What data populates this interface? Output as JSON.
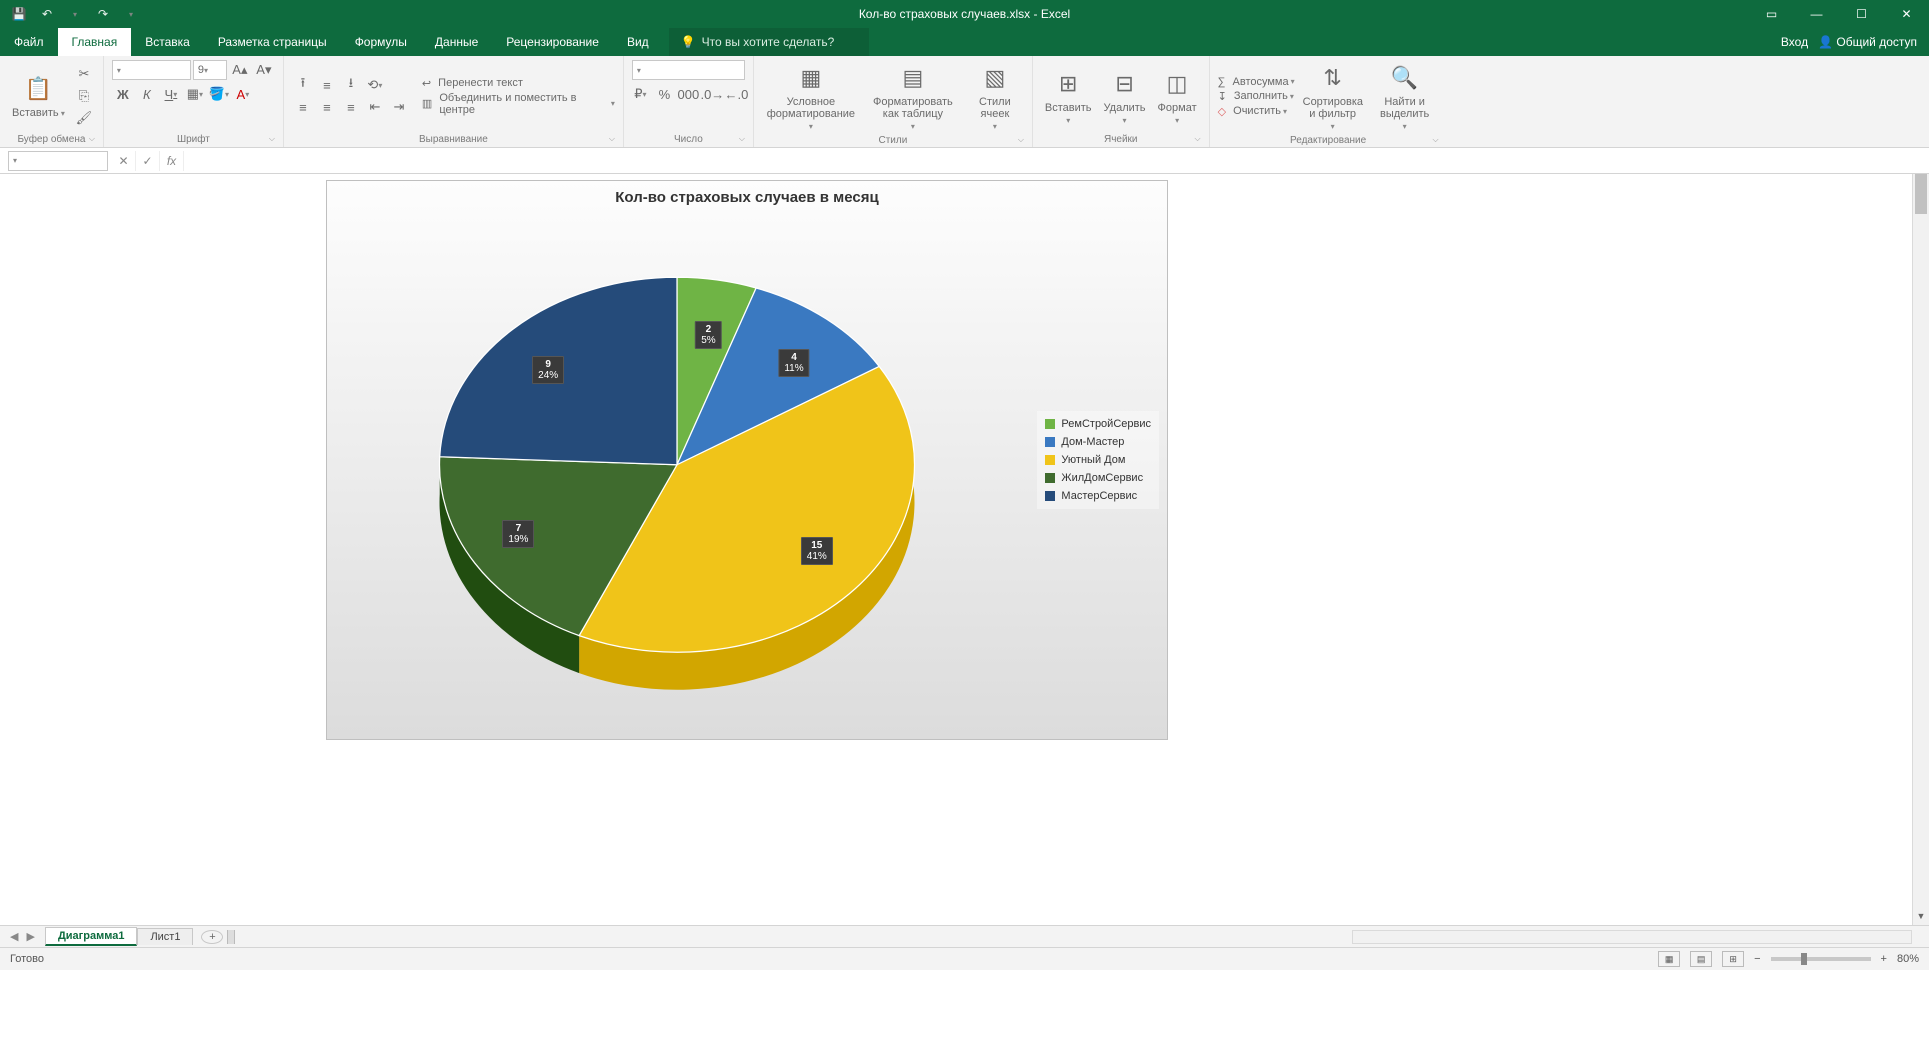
{
  "app": {
    "doc_title": "Кол-во страховых случаев.xlsx - Excel",
    "signin": "Вход",
    "share": "Общий доступ",
    "tellme_placeholder": "Что вы хотите сделать?"
  },
  "tabs": {
    "file": "Файл",
    "home": "Главная",
    "insert": "Вставка",
    "layout": "Разметка страницы",
    "formulas": "Формулы",
    "data": "Данные",
    "review": "Рецензирование",
    "view": "Вид"
  },
  "ribbon": {
    "clipboard": {
      "paste": "Вставить",
      "label": "Буфер обмена"
    },
    "font": {
      "label": "Шрифт",
      "size": "9",
      "bold": "Ж",
      "italic": "К",
      "underline": "Ч"
    },
    "alignment": {
      "label": "Выравнивание",
      "wrap": "Перенести текст",
      "merge": "Объединить и поместить в центре"
    },
    "number": {
      "label": "Число"
    },
    "styles": {
      "label": "Стили",
      "cond": "Условное форматирование",
      "table": "Форматировать как таблицу",
      "cell": "Стили ячеек"
    },
    "cells": {
      "label": "Ячейки",
      "insert": "Вставить",
      "delete": "Удалить",
      "format": "Формат"
    },
    "editing": {
      "label": "Редактирование",
      "autosum": "Автосумма",
      "fill": "Заполнить",
      "clear": "Очистить",
      "sort": "Сортировка и фильтр",
      "find": "Найти и выделить"
    }
  },
  "chart_data": {
    "type": "pie",
    "title": "Кол-во страховых случаев в месяц",
    "series": [
      {
        "name": "РемСтройСервис",
        "value": 2,
        "pct": "5%",
        "color": "#6fb445"
      },
      {
        "name": "Дом-Мастер",
        "value": 4,
        "pct": "11%",
        "color": "#3a79c1"
      },
      {
        "name": "Уютный Дом",
        "value": 15,
        "pct": "41%",
        "color": "#f0c419"
      },
      {
        "name": "ЖилДомСервис",
        "value": 7,
        "pct": "19%",
        "color": "#3f6b2e"
      },
      {
        "name": "МастерСервис",
        "value": 9,
        "pct": "24%",
        "color": "#254b7a"
      }
    ]
  },
  "sheets": {
    "active": "Диаграмма1",
    "other": "Лист1"
  },
  "status": {
    "ready": "Готово",
    "zoom": "80%"
  }
}
